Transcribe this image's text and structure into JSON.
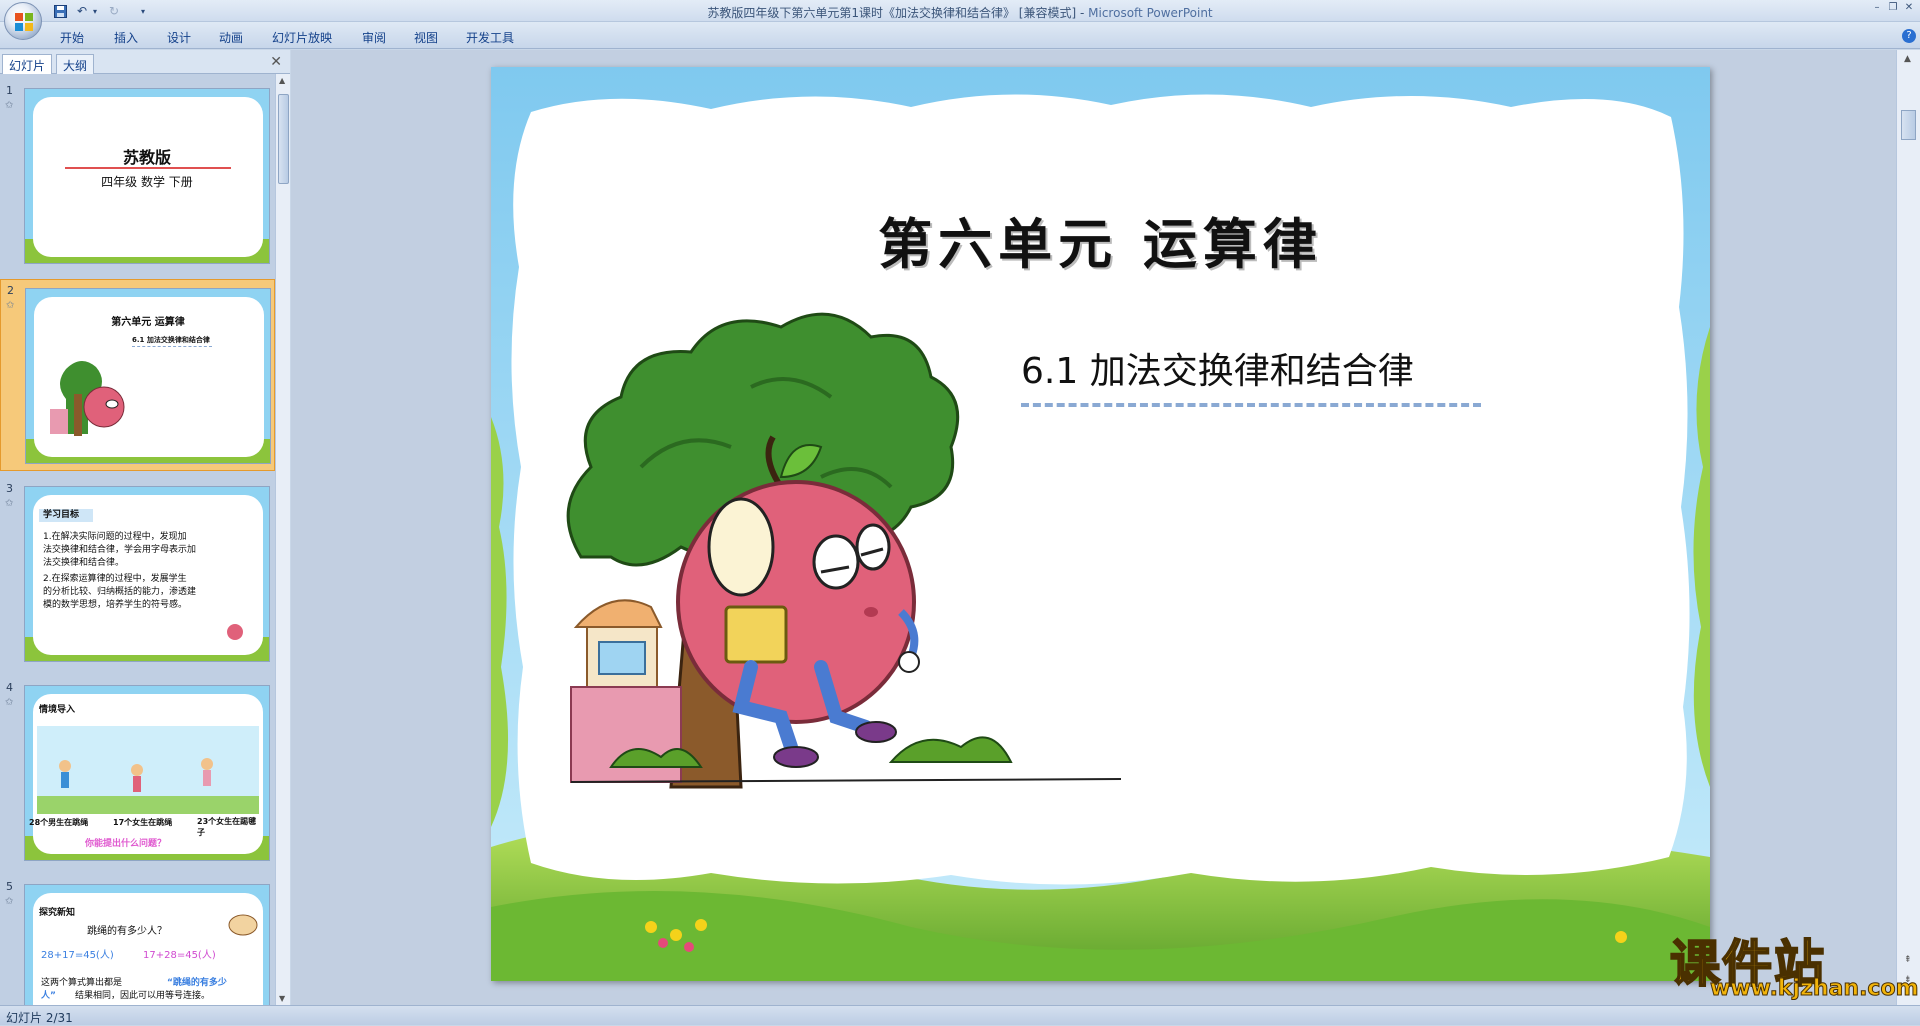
{
  "window": {
    "title": "苏教版四年级下第六单元第1课时《加法交换律和结合律》 [兼容模式] - ",
    "app_name": "Microsoft PowerPoint"
  },
  "ribbon": {
    "tabs": [
      "开始",
      "插入",
      "设计",
      "动画",
      "幻灯片放映",
      "审阅",
      "视图",
      "开发工具"
    ]
  },
  "left_pane": {
    "tabs": [
      "幻灯片",
      "大纲"
    ],
    "thumbnails": [
      {
        "number": "1",
        "title": "苏教版",
        "subtitle": "四年级 数学 下册"
      },
      {
        "number": "2",
        "title": "第六单元 运算律",
        "subtitle": "6.1 加法交换律和结合律"
      },
      {
        "number": "3",
        "heading": "学习目标",
        "lines": [
          "1.在解决实际问题的过程中，发现加",
          "法交换律和结合律，学会用字母表示加",
          "法交换律和结合律。",
          "2.在探索运算律的过程中，发展学生",
          "的分析比较、归纳概括的能力，渗透建",
          "模的数学思想，培养学生的符号感。"
        ]
      },
      {
        "number": "4",
        "heading": "情境导入",
        "captions": [
          "28个男生在跳绳",
          "17个女生在跳绳",
          "23个女生在踢毽子"
        ],
        "question": "你能提出什么问题？"
      },
      {
        "number": "5",
        "heading": "探究新知",
        "question": "跳绳的有多少人？",
        "eq1": "28+17=45(人)",
        "eq2": "17+28=45(人)",
        "line1": "这两个算式算出都是",
        "highlight": "“跳绳的有多少",
        "line2": "人”",
        "line3": "结果相同，因此可以用等号连接。"
      }
    ]
  },
  "slide": {
    "unit_title": "第六单元  运算律",
    "lesson_title": "6.1   加法交换律和结合律"
  },
  "watermark": {
    "main": "课件站",
    "url": "www.kjzhan.com"
  },
  "status_bar": {
    "text": "幻灯片 2/31"
  },
  "colors": {
    "sky": "#8fd3f2",
    "grass": "#8cc43c",
    "apple": "#e0617a",
    "tree": "#3f8f2f"
  }
}
